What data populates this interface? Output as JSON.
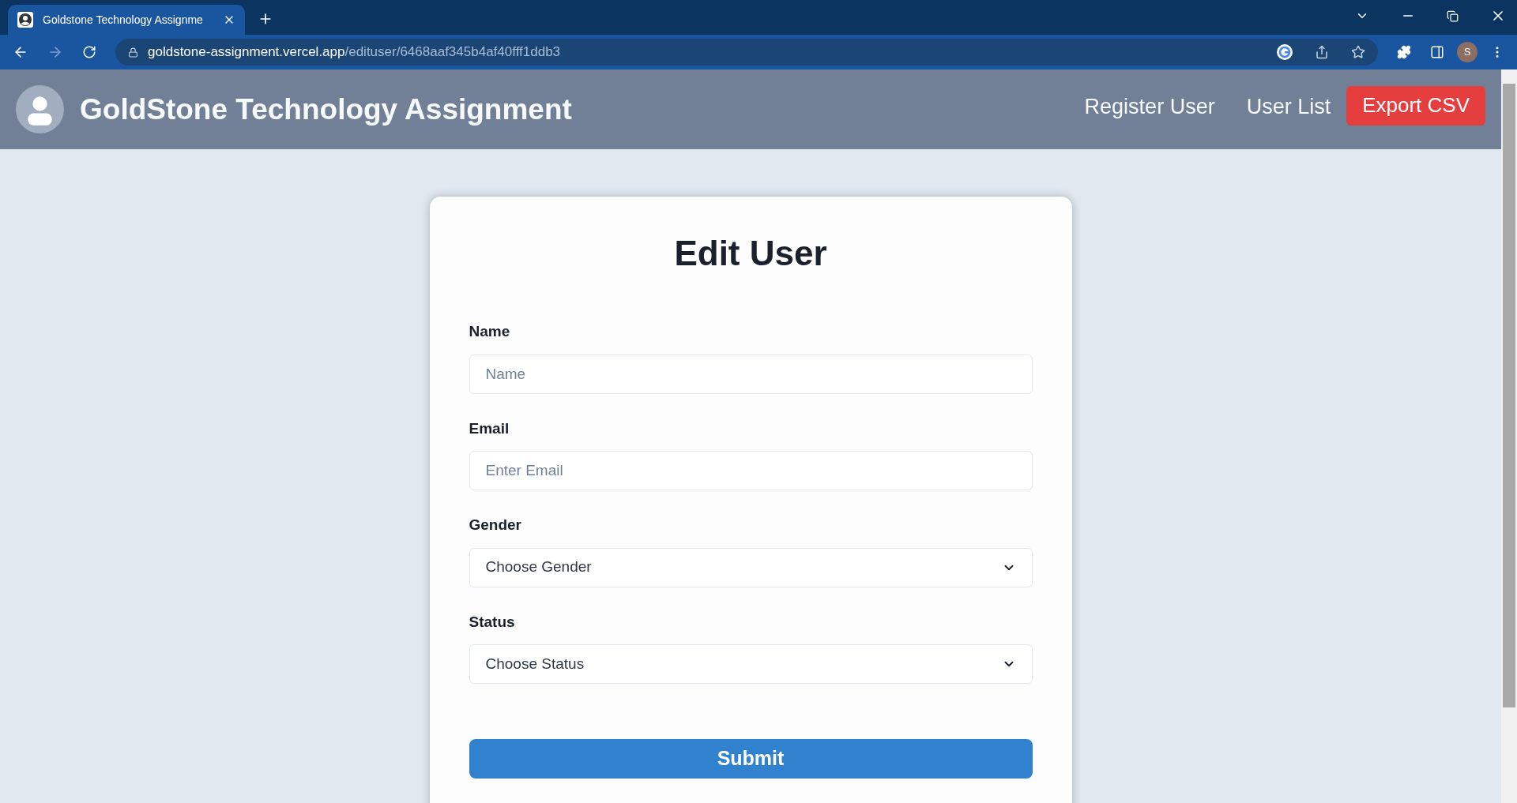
{
  "browser": {
    "tab": {
      "title": "Goldstone Technology Assignme",
      "selected": true
    },
    "url_host": "goldstone-assignment.vercel.app",
    "url_path": "/edituser/6468aaf345b4af40fff1ddb3",
    "profile": "S"
  },
  "header": {
    "title": "GoldStone Technology Assignment",
    "nav": [
      "Register User",
      "User List"
    ],
    "export_button": "Export CSV"
  },
  "form": {
    "title": "Edit User",
    "fields": [
      {
        "kind": "input",
        "label": "Name",
        "placeholder": "Name"
      },
      {
        "kind": "input",
        "label": "Email",
        "placeholder": "Enter Email"
      },
      {
        "kind": "select",
        "label": "Gender",
        "value": "Choose Gender"
      },
      {
        "kind": "select",
        "label": "Status",
        "value": "Choose Status"
      }
    ],
    "submit": "Submit"
  }
}
